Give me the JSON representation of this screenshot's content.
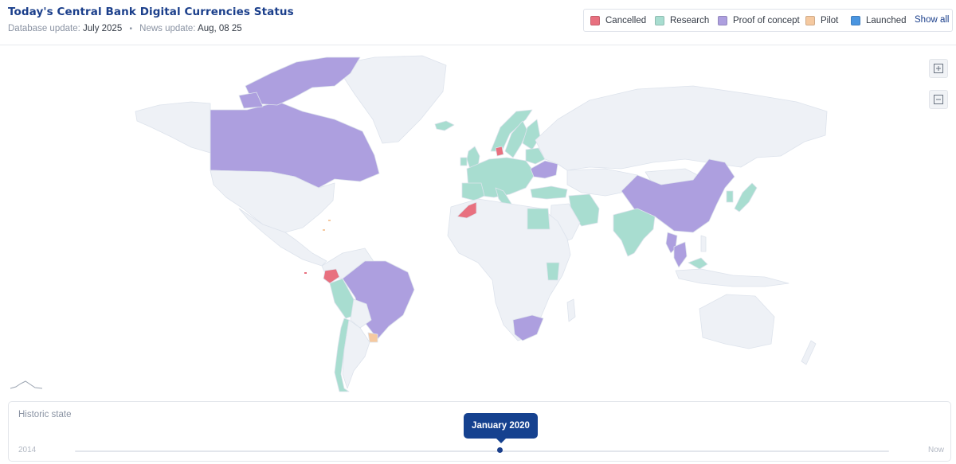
{
  "header": {
    "title": "Today's Central Bank Digital Currencies Status",
    "database_update_label": "Database update:",
    "database_update_value": "July 2025",
    "separator": "•",
    "news_update_label": "News update:",
    "news_update_value": "Aug, 08 25"
  },
  "legend": {
    "items": [
      {
        "label": "Cancelled",
        "color": "#e8707f"
      },
      {
        "label": "Research",
        "color": "#a8ddd0"
      },
      {
        "label": "Proof of concept",
        "color": "#ad9fdf"
      },
      {
        "label": "Pilot",
        "color": "#f5c9a0"
      },
      {
        "label": "Launched",
        "color": "#4a95e0"
      }
    ],
    "show_all": "Show all"
  },
  "map": {
    "colors": {
      "base": "#eef1f6",
      "border": "#dde3ec",
      "cancelled": "#e8707f",
      "research": "#a8ddd0",
      "proof_of_concept": "#ad9fdf",
      "pilot": "#f5c9a0"
    },
    "zoom_in_icon": "zoom-in-icon",
    "zoom_out_icon": "zoom-out-icon"
  },
  "history": {
    "label": "Historic state",
    "start": "2014",
    "end": "Now",
    "selected": "January 2020",
    "position": 0.52
  }
}
